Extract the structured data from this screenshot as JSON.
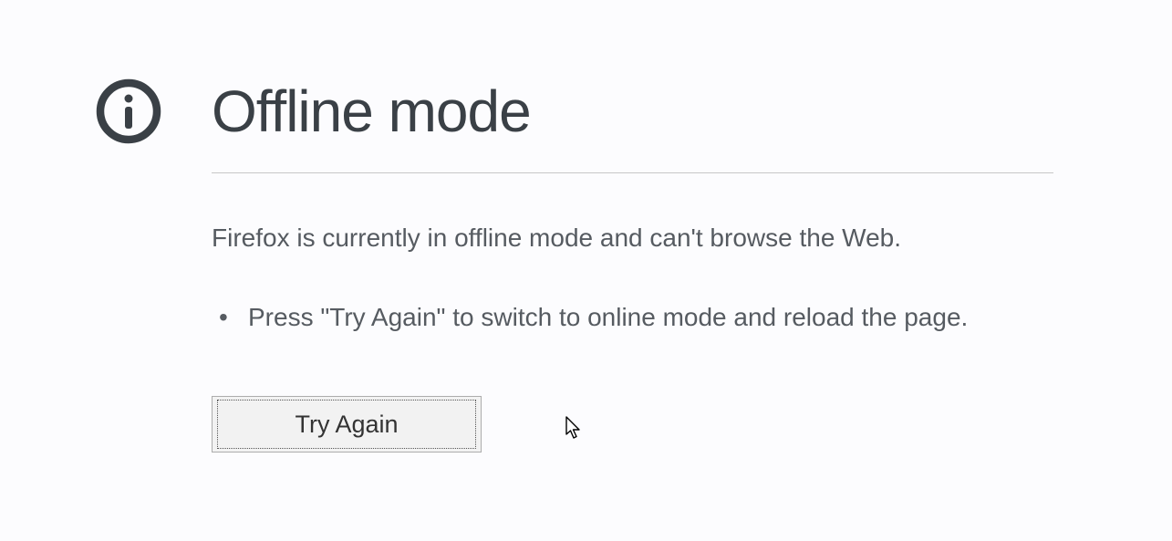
{
  "error": {
    "title": "Offline mode",
    "message": "Firefox is currently in offline mode and can't browse the Web.",
    "instructions": [
      "Press \"Try Again\" to switch to online mode and reload the page."
    ],
    "button_label": "Try Again"
  }
}
